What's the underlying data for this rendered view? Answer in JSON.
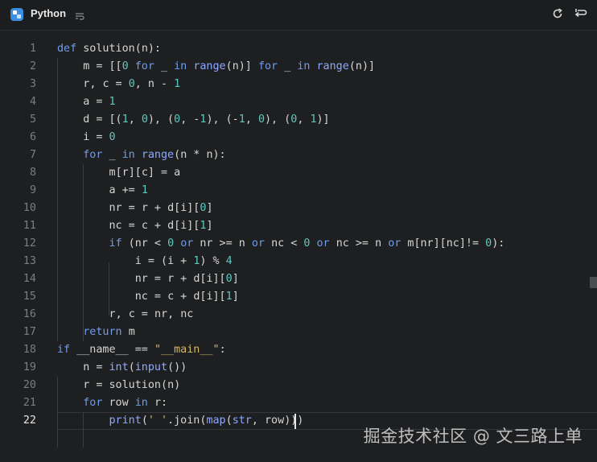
{
  "header": {
    "language": "Python",
    "icons": {
      "language": "python-logo-icon",
      "wrap": "text-wrap-icon",
      "reset": "reset-icon",
      "restore": "restore-code-icon"
    }
  },
  "editor": {
    "active_line": 22,
    "line_numbers": [
      "1",
      "2",
      "3",
      "4",
      "5",
      "6",
      "7",
      "8",
      "9",
      "10",
      "11",
      "12",
      "13",
      "14",
      "15",
      "16",
      "17",
      "18",
      "19",
      "20",
      "21",
      "22"
    ],
    "lines": [
      "def solution(n):",
      "    m = [[0 for _ in range(n)] for _ in range(n)]",
      "    r, c = 0, n - 1",
      "    a = 1",
      "    d = [(1, 0), (0, -1), (-1, 0), (0, 1)]",
      "    i = 0",
      "    for _ in range(n * n):",
      "        m[r][c] = a",
      "        a += 1",
      "        nr = r + d[i][0]",
      "        nc = c + d[i][1]",
      "        if (nr < 0 or nr >= n or nc < 0 or nc >= n or m[nr][nc]!= 0):",
      "            i = (i + 1) % 4",
      "            nr = r + d[i][0]",
      "            nc = c + d[i][1]",
      "        r, c = nr, nc",
      "    return m",
      "if __name__ == \"__main__\":",
      "    n = int(input())",
      "    r = solution(n)",
      "    for row in r:",
      "        print(' '.join(map(str, row)))"
    ]
  },
  "watermark": "掘金技术社区 @ 文三路上单",
  "colors": {
    "keyword": "#6f9cf0",
    "number": "#5fc8c0",
    "string": "#d6b86a",
    "background": "#1e1f20"
  }
}
